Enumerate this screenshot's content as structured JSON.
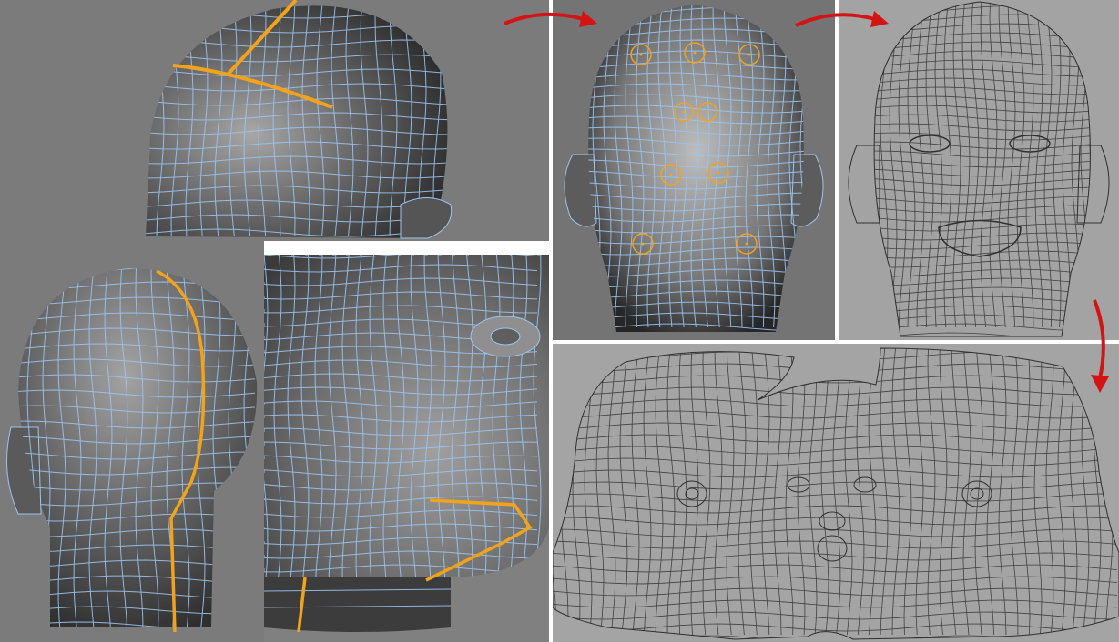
{
  "panels": [
    {
      "id": "head-top-view",
      "kind": "3d-mesh"
    },
    {
      "id": "head-back-view",
      "kind": "3d-mesh"
    },
    {
      "id": "head-underside-view",
      "kind": "3d-mesh"
    },
    {
      "id": "head-front-view",
      "kind": "3d-mesh-with-pins"
    },
    {
      "id": "head-front-wireframe",
      "kind": "wireframe"
    },
    {
      "id": "uv-layout",
      "kind": "uv-unwrap"
    }
  ],
  "colors": {
    "mesh_wire": "#9cc4ee",
    "seam": "#f2a21b",
    "pin_circle": "#f2a21b",
    "arrow": "#d41414",
    "viewport_bg": "#7b7b7b",
    "wireframe_bg": "#a3a3a3",
    "wireframe_line": "#2f2f2f"
  },
  "icons": [
    "process-arrow-icon",
    "pin-circle-icon"
  ]
}
